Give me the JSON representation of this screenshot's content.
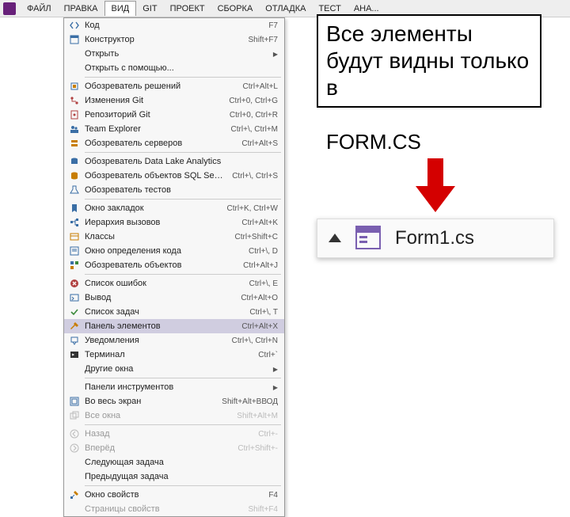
{
  "menubar": {
    "items": [
      "ФАЙЛ",
      "ПРАВКА",
      "ВИД",
      "GIT",
      "ПРОЕКТ",
      "СБОРКА",
      "ОТЛАДКА",
      "ТЕСТ",
      "АНА..."
    ],
    "openIndex": 2
  },
  "dropdown": {
    "groups": [
      [
        {
          "label": "Код",
          "shortcut": "F7",
          "icon": "code"
        },
        {
          "label": "Конструктор",
          "shortcut": "Shift+F7",
          "icon": "designer"
        },
        {
          "label": "Открыть",
          "submenu": true
        },
        {
          "label": "Открыть с помощью...",
          "icon": ""
        }
      ],
      [
        {
          "label": "Обозреватель решений",
          "shortcut": "Ctrl+Alt+L",
          "icon": "solution"
        },
        {
          "label": "Изменения Git",
          "shortcut": "Ctrl+0, Ctrl+G",
          "icon": "git"
        },
        {
          "label": "Репозиторий Git",
          "shortcut": "Ctrl+0, Ctrl+R",
          "icon": "gitrepo"
        },
        {
          "label": "Team Explorer",
          "shortcut": "Ctrl+\\, Ctrl+M",
          "icon": "team"
        },
        {
          "label": "Обозреватель серверов",
          "shortcut": "Ctrl+Alt+S",
          "icon": "server"
        }
      ],
      [
        {
          "label": "Обозреватель Data Lake Analytics",
          "icon": "datalake"
        },
        {
          "label": "Обозреватель объектов SQL Server",
          "shortcut": "Ctrl+\\, Ctrl+S",
          "icon": "sql"
        },
        {
          "label": "Обозреватель тестов",
          "icon": "test"
        }
      ],
      [
        {
          "label": "Окно закладок",
          "shortcut": "Ctrl+K, Ctrl+W",
          "icon": "bookmark"
        },
        {
          "label": "Иерархия вызовов",
          "shortcut": "Ctrl+Alt+K",
          "icon": "callhier"
        },
        {
          "label": "Классы",
          "shortcut": "Ctrl+Shift+C",
          "icon": "class"
        },
        {
          "label": "Окно определения кода",
          "shortcut": "Ctrl+\\, D",
          "icon": "codedef"
        },
        {
          "label": "Обозреватель объектов",
          "shortcut": "Ctrl+Alt+J",
          "icon": "objbrowser"
        }
      ],
      [
        {
          "label": "Список ошибок",
          "shortcut": "Ctrl+\\, E",
          "icon": "errors"
        },
        {
          "label": "Вывод",
          "shortcut": "Ctrl+Alt+O",
          "icon": "output"
        },
        {
          "label": "Список задач",
          "shortcut": "Ctrl+\\, T",
          "icon": "tasks"
        },
        {
          "label": "Панель элементов",
          "shortcut": "Ctrl+Alt+X",
          "icon": "toolbox",
          "selected": true
        },
        {
          "label": "Уведомления",
          "shortcut": "Ctrl+\\, Ctrl+N",
          "icon": "notify"
        },
        {
          "label": "Терминал",
          "shortcut": "Ctrl+`",
          "icon": "terminal"
        },
        {
          "label": "Другие окна",
          "submenu": true
        }
      ],
      [
        {
          "label": "Панели инструментов",
          "submenu": true
        },
        {
          "label": "Во весь экран",
          "shortcut": "Shift+Alt+ВВОД",
          "icon": "fullscreen"
        },
        {
          "label": "Все окна",
          "shortcut": "Shift+Alt+M",
          "icon": "allwin",
          "disabled": true
        }
      ],
      [
        {
          "label": "Назад",
          "shortcut": "Ctrl+-",
          "icon": "back",
          "disabled": true
        },
        {
          "label": "Вперёд",
          "shortcut": "Ctrl+Shift+-",
          "icon": "forward",
          "disabled": true
        },
        {
          "label": "Следующая задача"
        },
        {
          "label": "Предыдущая задача"
        }
      ],
      [
        {
          "label": "Окно свойств",
          "shortcut": "F4",
          "icon": "props"
        },
        {
          "label": "Страницы свойств",
          "shortcut": "Shift+F4",
          "disabled": true
        }
      ]
    ]
  },
  "annotation": {
    "main": "Все элементы будут видны только в",
    "sub": "FORM.CS"
  },
  "formchip": {
    "label": "Form1.cs"
  }
}
